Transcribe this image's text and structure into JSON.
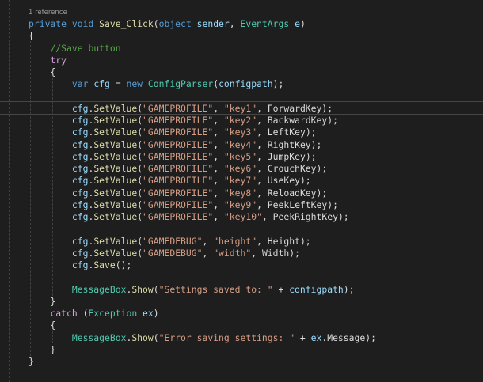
{
  "codelens": "1 reference",
  "lines": [
    [
      [
        "kw",
        "private "
      ],
      [
        "kw",
        "void "
      ],
      [
        "fn",
        "Save_Click"
      ],
      [
        "pl",
        "("
      ],
      [
        "kw",
        "object "
      ],
      [
        "var",
        "sender"
      ],
      [
        "pl",
        ", "
      ],
      [
        "ty",
        "EventArgs "
      ],
      [
        "var",
        "e"
      ],
      [
        "pl",
        ")"
      ]
    ],
    [
      [
        "pl",
        "{"
      ]
    ],
    [
      [
        "pl",
        "    "
      ],
      [
        "cm",
        "//Save button"
      ]
    ],
    [
      [
        "pl",
        "    "
      ],
      [
        "ctl",
        "try"
      ]
    ],
    [
      [
        "pl",
        "    {"
      ]
    ],
    [
      [
        "pl",
        "        "
      ],
      [
        "kw",
        "var "
      ],
      [
        "var",
        "cfg"
      ],
      [
        "pl",
        " = "
      ],
      [
        "kw",
        "new "
      ],
      [
        "ty",
        "ConfigParser"
      ],
      [
        "pl",
        "("
      ],
      [
        "var",
        "configpath"
      ],
      [
        "pl",
        ");"
      ]
    ],
    [],
    [
      [
        "pl",
        "        "
      ],
      [
        "var",
        "cfg"
      ],
      [
        "pl",
        "."
      ],
      [
        "fn",
        "SetValue"
      ],
      [
        "pl",
        "("
      ],
      [
        "str",
        "\"GAMEPROFILE\""
      ],
      [
        "pl",
        ", "
      ],
      [
        "str",
        "\"key1\""
      ],
      [
        "pl",
        ", "
      ],
      [
        "pl",
        "ForwardKey"
      ],
      [
        "pl",
        ");"
      ]
    ],
    [
      [
        "pl",
        "        "
      ],
      [
        "var",
        "cfg"
      ],
      [
        "pl",
        "."
      ],
      [
        "fn",
        "SetValue"
      ],
      [
        "pl",
        "("
      ],
      [
        "str",
        "\"GAMEPROFILE\""
      ],
      [
        "pl",
        ", "
      ],
      [
        "str",
        "\"key2\""
      ],
      [
        "pl",
        ", "
      ],
      [
        "pl",
        "BackwardKey"
      ],
      [
        "pl",
        ");"
      ]
    ],
    [
      [
        "pl",
        "        "
      ],
      [
        "var",
        "cfg"
      ],
      [
        "pl",
        "."
      ],
      [
        "fn",
        "SetValue"
      ],
      [
        "pl",
        "("
      ],
      [
        "str",
        "\"GAMEPROFILE\""
      ],
      [
        "pl",
        ", "
      ],
      [
        "str",
        "\"key3\""
      ],
      [
        "pl",
        ", "
      ],
      [
        "pl",
        "LeftKey"
      ],
      [
        "pl",
        ");"
      ]
    ],
    [
      [
        "pl",
        "        "
      ],
      [
        "var",
        "cfg"
      ],
      [
        "pl",
        "."
      ],
      [
        "fn",
        "SetValue"
      ],
      [
        "pl",
        "("
      ],
      [
        "str",
        "\"GAMEPROFILE\""
      ],
      [
        "pl",
        ", "
      ],
      [
        "str",
        "\"key4\""
      ],
      [
        "pl",
        ", "
      ],
      [
        "pl",
        "RightKey"
      ],
      [
        "pl",
        ");"
      ]
    ],
    [
      [
        "pl",
        "        "
      ],
      [
        "var",
        "cfg"
      ],
      [
        "pl",
        "."
      ],
      [
        "fn",
        "SetValue"
      ],
      [
        "pl",
        "("
      ],
      [
        "str",
        "\"GAMEPROFILE\""
      ],
      [
        "pl",
        ", "
      ],
      [
        "str",
        "\"key5\""
      ],
      [
        "pl",
        ", "
      ],
      [
        "pl",
        "JumpKey"
      ],
      [
        "pl",
        ");"
      ]
    ],
    [
      [
        "pl",
        "        "
      ],
      [
        "var",
        "cfg"
      ],
      [
        "pl",
        "."
      ],
      [
        "fn",
        "SetValue"
      ],
      [
        "pl",
        "("
      ],
      [
        "str",
        "\"GAMEPROFILE\""
      ],
      [
        "pl",
        ", "
      ],
      [
        "str",
        "\"key6\""
      ],
      [
        "pl",
        ", "
      ],
      [
        "pl",
        "CrouchKey"
      ],
      [
        "pl",
        ");"
      ]
    ],
    [
      [
        "pl",
        "        "
      ],
      [
        "var",
        "cfg"
      ],
      [
        "pl",
        "."
      ],
      [
        "fn",
        "SetValue"
      ],
      [
        "pl",
        "("
      ],
      [
        "str",
        "\"GAMEPROFILE\""
      ],
      [
        "pl",
        ", "
      ],
      [
        "str",
        "\"key7\""
      ],
      [
        "pl",
        ", "
      ],
      [
        "pl",
        "UseKey"
      ],
      [
        "pl",
        ");"
      ]
    ],
    [
      [
        "pl",
        "        "
      ],
      [
        "var",
        "cfg"
      ],
      [
        "pl",
        "."
      ],
      [
        "fn",
        "SetValue"
      ],
      [
        "pl",
        "("
      ],
      [
        "str",
        "\"GAMEPROFILE\""
      ],
      [
        "pl",
        ", "
      ],
      [
        "str",
        "\"key8\""
      ],
      [
        "pl",
        ", "
      ],
      [
        "pl",
        "ReloadKey"
      ],
      [
        "pl",
        ");"
      ]
    ],
    [
      [
        "pl",
        "        "
      ],
      [
        "var",
        "cfg"
      ],
      [
        "pl",
        "."
      ],
      [
        "fn",
        "SetValue"
      ],
      [
        "pl",
        "("
      ],
      [
        "str",
        "\"GAMEPROFILE\""
      ],
      [
        "pl",
        ", "
      ],
      [
        "str",
        "\"key9\""
      ],
      [
        "pl",
        ", "
      ],
      [
        "pl",
        "PeekLeftKey"
      ],
      [
        "pl",
        ");"
      ]
    ],
    [
      [
        "pl",
        "        "
      ],
      [
        "var",
        "cfg"
      ],
      [
        "pl",
        "."
      ],
      [
        "fn",
        "SetValue"
      ],
      [
        "pl",
        "("
      ],
      [
        "str",
        "\"GAMEPROFILE\""
      ],
      [
        "pl",
        ", "
      ],
      [
        "str",
        "\"key10\""
      ],
      [
        "pl",
        ", "
      ],
      [
        "pl",
        "PeekRightKey"
      ],
      [
        "pl",
        ");"
      ]
    ],
    [],
    [
      [
        "pl",
        "        "
      ],
      [
        "var",
        "cfg"
      ],
      [
        "pl",
        "."
      ],
      [
        "fn",
        "SetValue"
      ],
      [
        "pl",
        "("
      ],
      [
        "str",
        "\"GAMEDEBUG\""
      ],
      [
        "pl",
        ", "
      ],
      [
        "str",
        "\"height\""
      ],
      [
        "pl",
        ", "
      ],
      [
        "pl",
        "Height"
      ],
      [
        "pl",
        ");"
      ]
    ],
    [
      [
        "pl",
        "        "
      ],
      [
        "var",
        "cfg"
      ],
      [
        "pl",
        "."
      ],
      [
        "fn",
        "SetValue"
      ],
      [
        "pl",
        "("
      ],
      [
        "str",
        "\"GAMEDEBUG\""
      ],
      [
        "pl",
        ", "
      ],
      [
        "str",
        "\"width\""
      ],
      [
        "pl",
        ", "
      ],
      [
        "pl",
        "Width"
      ],
      [
        "pl",
        ");"
      ]
    ],
    [
      [
        "pl",
        "        "
      ],
      [
        "var",
        "cfg"
      ],
      [
        "pl",
        "."
      ],
      [
        "fn",
        "Save"
      ],
      [
        "pl",
        "();"
      ]
    ],
    [],
    [
      [
        "pl",
        "        "
      ],
      [
        "ty",
        "MessageBox"
      ],
      [
        "pl",
        "."
      ],
      [
        "fn",
        "Show"
      ],
      [
        "pl",
        "("
      ],
      [
        "str",
        "\"Settings saved to: \""
      ],
      [
        "pl",
        " + "
      ],
      [
        "var",
        "configpath"
      ],
      [
        "pl",
        ");"
      ]
    ],
    [
      [
        "pl",
        "    }"
      ]
    ],
    [
      [
        "pl",
        "    "
      ],
      [
        "ctl",
        "catch "
      ],
      [
        "pl",
        "("
      ],
      [
        "ty",
        "Exception "
      ],
      [
        "var",
        "ex"
      ],
      [
        "pl",
        ")"
      ]
    ],
    [
      [
        "pl",
        "    {"
      ]
    ],
    [
      [
        "pl",
        "        "
      ],
      [
        "ty",
        "MessageBox"
      ],
      [
        "pl",
        "."
      ],
      [
        "fn",
        "Show"
      ],
      [
        "pl",
        "("
      ],
      [
        "str",
        "\"Error saving settings: \""
      ],
      [
        "pl",
        " + "
      ],
      [
        "var",
        "ex"
      ],
      [
        "pl",
        "."
      ],
      [
        "pl",
        "Message"
      ],
      [
        "pl",
        ");"
      ]
    ],
    [
      [
        "pl",
        "    }"
      ]
    ],
    [
      [
        "pl",
        "}"
      ]
    ]
  ]
}
